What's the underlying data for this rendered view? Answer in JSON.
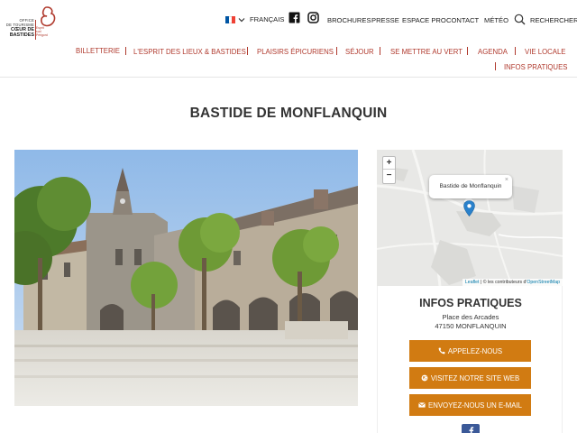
{
  "logo": {
    "office_line1": "OFFICE",
    "office_line2": "DE TOURISME",
    "brand_line1": "CŒUR DE",
    "brand_line2": "BASTIDES",
    "tagline_line1": "Esprit",
    "tagline_line2": "sud",
    "tagline_line3": "Périgord"
  },
  "topnav": {
    "language": "FRANÇAIS",
    "brochures": "BROCHURES",
    "presse": "PRESSE",
    "espace_pro": "ESPACE PRO",
    "contact": "CONTACT",
    "meteo": "MÉTÉO",
    "search": "RECHERCHER"
  },
  "mainnav": {
    "items": [
      "BILLETTERIE",
      "L'ESPRIT DES LIEUX & BASTIDES",
      "PLAISIRS ÉPICURIENS",
      "SÉJOUR",
      "SE METTRE AU VERT",
      "AGENDA",
      "VIE LOCALE",
      "INFOS PRATIQUES"
    ]
  },
  "page": {
    "title": "BASTIDE DE MONFLANQUIN"
  },
  "map": {
    "zoom_in": "+",
    "zoom_out": "−",
    "popup_label": "Bastide de Monflanquin",
    "popup_close": "×",
    "attribution_leaflet": "Leaflet",
    "attribution_text": " | © les contributeurs d'",
    "attribution_osm": "OpenStreetMap"
  },
  "infos": {
    "title": "INFOS PRATIQUES",
    "address_line1": "Place des Arcades",
    "address_line2": "47150 MONFLANQUIN",
    "call_button": "APPELEZ-NOUS",
    "website_button": "VISITEZ NOTRE SITE WEB",
    "email_button": "ENVOYEZ-NOUS UN E-MAIL"
  },
  "colors": {
    "brand_red": "#b03a2e",
    "button_orange": "#d17b12",
    "facebook_blue": "#3b5998",
    "map_pin": "#2a81cb"
  },
  "icons": {
    "language_flag": "france-flag-icon",
    "language_dropdown": "chevron-down-icon",
    "facebook": "facebook-icon",
    "instagram": "instagram-icon",
    "search": "search-icon",
    "call": "phone-icon",
    "website": "globe-icon",
    "email": "envelope-icon",
    "map_marker": "map-pin-icon"
  }
}
